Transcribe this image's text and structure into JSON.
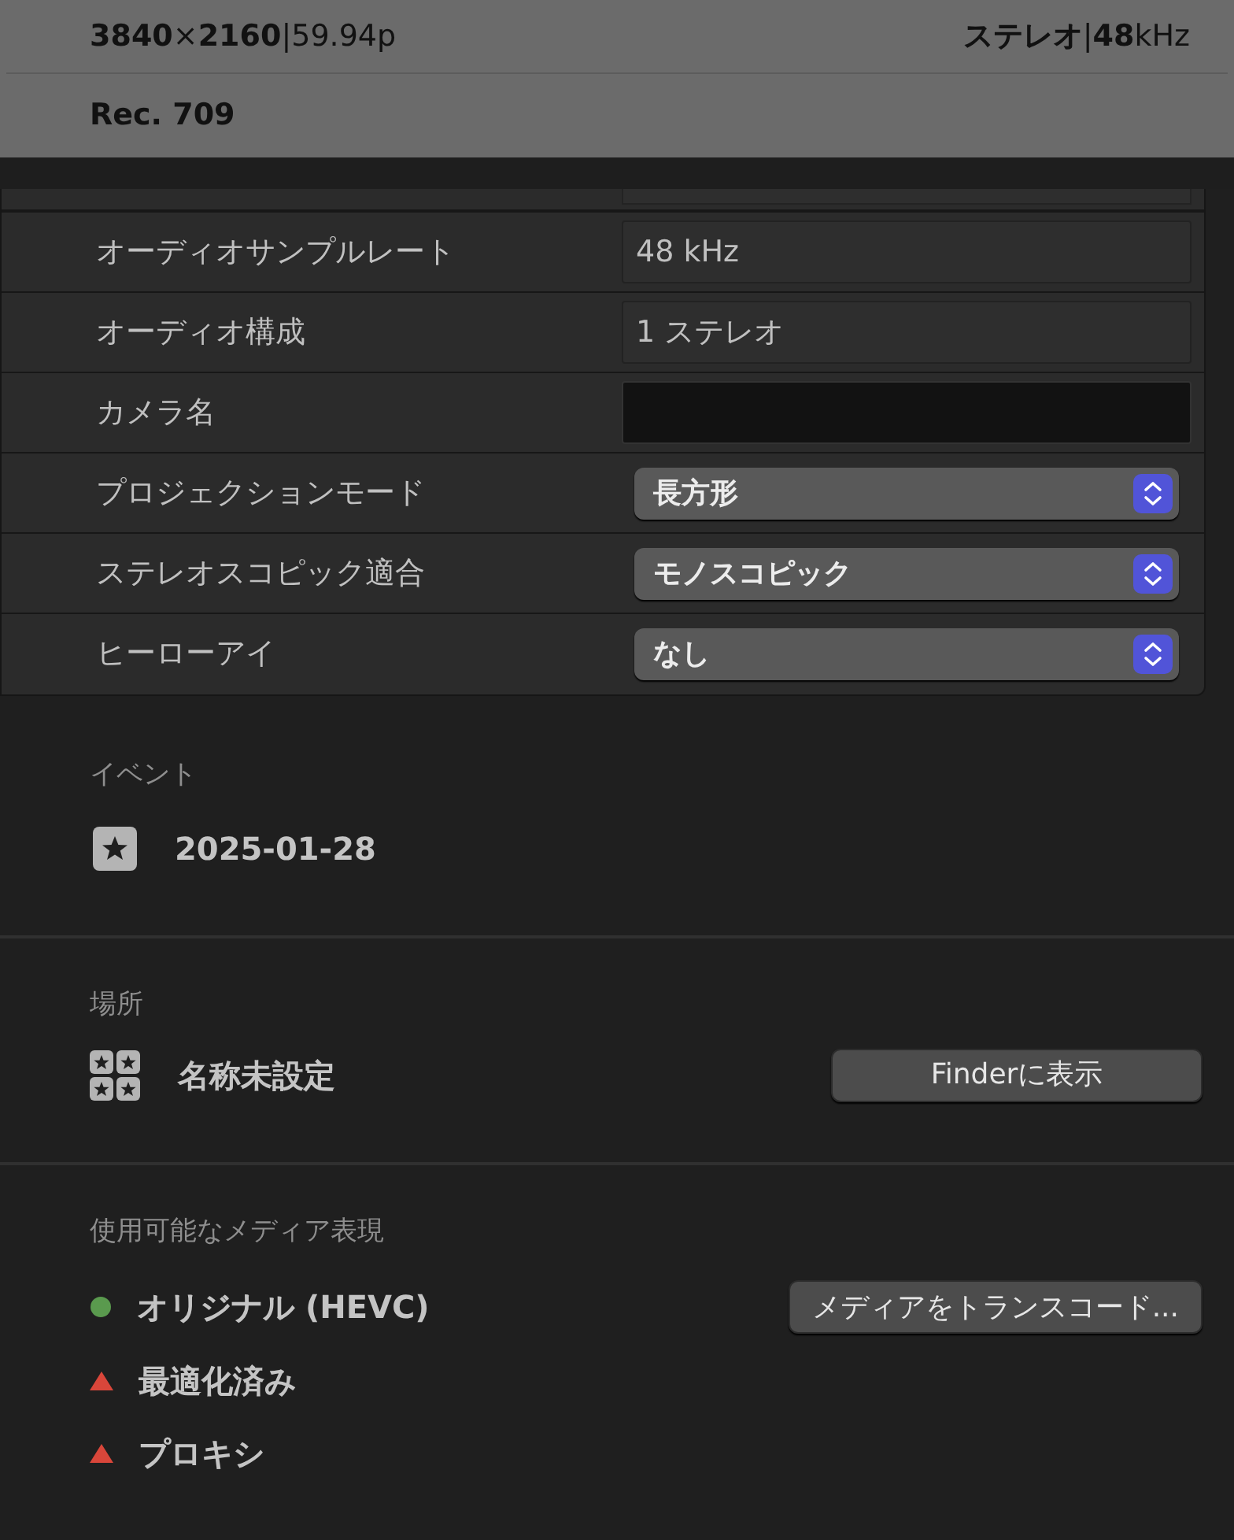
{
  "header": {
    "format": "**3840**×**2160**|59.94p",
    "audio": "**ステレオ**|**48**kHz",
    "color_space": "Rec. 709"
  },
  "properties": [
    {
      "label": "オーディオサンプルレート",
      "kind": "text",
      "value": "48 kHz"
    },
    {
      "label": "オーディオ構成",
      "kind": "text",
      "value": "1 ステレオ"
    },
    {
      "label": "カメラ名",
      "kind": "field"
    },
    {
      "label": "プロジェクションモード",
      "kind": "popup",
      "value": "長方形"
    },
    {
      "label": "ステレオスコピック適合",
      "kind": "popup",
      "value": "モノスコピック"
    },
    {
      "label": "ヒーローアイ",
      "kind": "popup",
      "value": "なし"
    }
  ],
  "event": {
    "heading": "イベント",
    "name": "2025-01-28"
  },
  "location": {
    "heading": "場所",
    "name": "名称未設定",
    "button": "Finderに表示"
  },
  "media": {
    "heading": "使用可能なメディア表現",
    "button": "メディアをトランスコード...",
    "items": [
      {
        "label": "オリジナル (HEVC)",
        "kind": "dot",
        "color": "#5a9a4e"
      },
      {
        "label": "最適化済み",
        "kind": "triangle",
        "color": "#d9463a"
      },
      {
        "label": "プロキシ",
        "kind": "triangle",
        "color": "#d9463a"
      }
    ]
  }
}
